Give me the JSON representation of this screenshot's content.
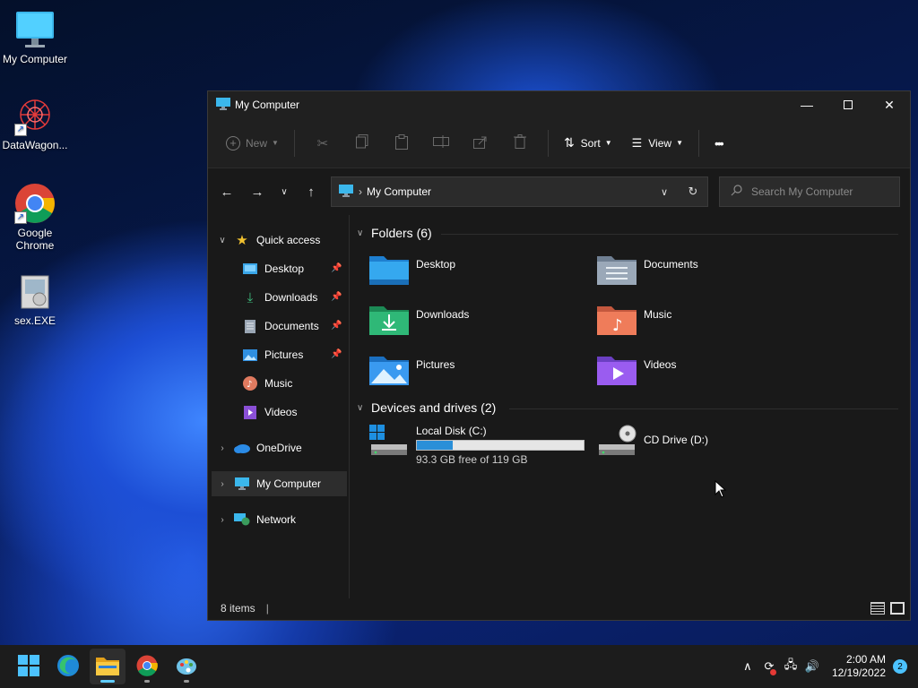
{
  "desktop": {
    "icons": [
      {
        "label": "My Computer"
      },
      {
        "label": "DataWagon..."
      },
      {
        "label": "Google Chrome"
      },
      {
        "label": "sex.EXE"
      }
    ]
  },
  "window": {
    "title": "My Computer",
    "toolbar": {
      "new_label": "New",
      "sort_label": "Sort",
      "view_label": "View",
      "more_label": "•••"
    },
    "address": {
      "crumb": "My Computer"
    },
    "search": {
      "placeholder": "Search My Computer"
    },
    "sidebar": {
      "quick_access": "Quick access",
      "quick_items": [
        {
          "label": "Desktop",
          "pinned": true
        },
        {
          "label": "Downloads",
          "pinned": true
        },
        {
          "label": "Documents",
          "pinned": true
        },
        {
          "label": "Pictures",
          "pinned": true
        },
        {
          "label": "Music",
          "pinned": false
        },
        {
          "label": "Videos",
          "pinned": false
        }
      ],
      "onedrive": "OneDrive",
      "my_computer": "My Computer",
      "network": "Network"
    },
    "content": {
      "folders_header": "Folders (6)",
      "folders": [
        {
          "label": "Desktop"
        },
        {
          "label": "Documents"
        },
        {
          "label": "Downloads"
        },
        {
          "label": "Music"
        },
        {
          "label": "Pictures"
        },
        {
          "label": "Videos"
        }
      ],
      "drives_header": "Devices and drives (2)",
      "drives": [
        {
          "label": "Local Disk (C:)",
          "free_text": "93.3 GB free of 119 GB",
          "used_fraction": 0.216
        },
        {
          "label": "CD Drive (D:)"
        }
      ]
    },
    "status": {
      "items": "8 items"
    }
  },
  "taskbar": {
    "time": "2:00 AM",
    "date": "12/19/2022",
    "notifications": "2"
  },
  "colors": {
    "accent": "#60cdff",
    "drive_fill": "#2a8fd8",
    "window_bg": "#191919"
  }
}
